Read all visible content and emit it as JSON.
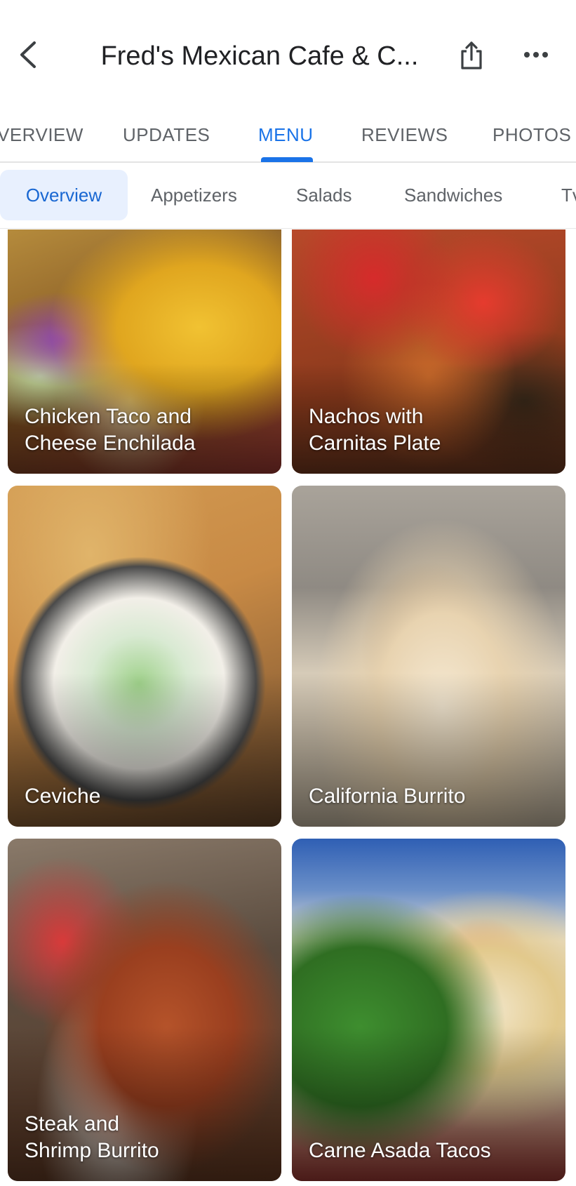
{
  "header": {
    "title": "Fred's Mexican Cafe & C...",
    "back_icon": "chevron-left-icon",
    "share_icon": "share-icon",
    "more_icon": "more-horizontal-icon"
  },
  "main_tabs": [
    {
      "label": "VERVIEW",
      "active": false
    },
    {
      "label": "UPDATES",
      "active": false
    },
    {
      "label": "MENU",
      "active": true
    },
    {
      "label": "REVIEWS",
      "active": false
    },
    {
      "label": "PHOTOS",
      "active": false
    }
  ],
  "sub_tabs": [
    {
      "label": "Overview",
      "active": true
    },
    {
      "label": "Appetizers",
      "active": false
    },
    {
      "label": "Salads",
      "active": false
    },
    {
      "label": "Sandwiches",
      "active": false
    },
    {
      "label": "Tv",
      "active": false
    }
  ],
  "menu_items": [
    {
      "name": "Chicken Taco and\nCheese Enchilada"
    },
    {
      "name": "Nachos with\nCarnitas Plate"
    },
    {
      "name": "Ceviche"
    },
    {
      "name": "California Burrito"
    },
    {
      "name": "Steak and\nShrimp Burrito"
    },
    {
      "name": "Carne Asada Tacos"
    }
  ],
  "colors": {
    "accent": "#1a73e8",
    "chip_bg": "#e8f0fe",
    "text_secondary": "#5f6368"
  }
}
